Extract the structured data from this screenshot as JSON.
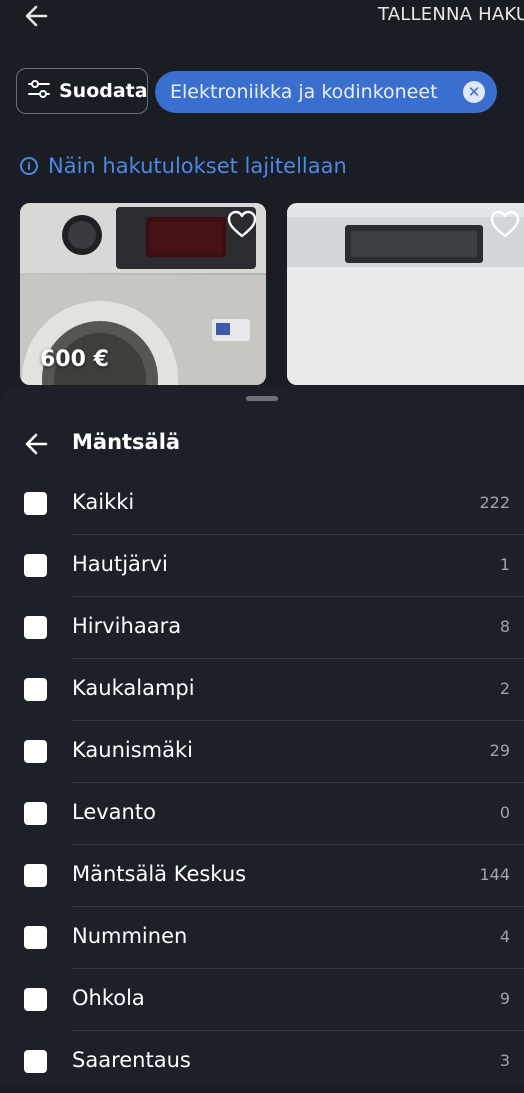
{
  "header": {
    "save_search": "TALLENNA HAKU"
  },
  "filters": {
    "filter_label": "Suodata",
    "category_chip": "Elektroniikka ja kodinkoneet",
    "chip_remove": "✕"
  },
  "info": {
    "text": "Näin hakutulokset lajitellaan",
    "icon": "i"
  },
  "listings": [
    {
      "price": "600 €"
    },
    {
      "price": ""
    }
  ],
  "sheet": {
    "title": "Mäntsälä",
    "options": [
      {
        "label": "Kaikki",
        "count": "222",
        "checked": false
      },
      {
        "label": "Hautjärvi",
        "count": "1",
        "checked": false
      },
      {
        "label": "Hirvihaara",
        "count": "8",
        "checked": false
      },
      {
        "label": "Kaukalampi",
        "count": "2",
        "checked": false
      },
      {
        "label": "Kaunismäki",
        "count": "29",
        "checked": false
      },
      {
        "label": "Levanto",
        "count": "0",
        "checked": false
      },
      {
        "label": "Mäntsälä Keskus",
        "count": "144",
        "checked": false
      },
      {
        "label": "Numminen",
        "count": "4",
        "checked": false
      },
      {
        "label": "Ohkola",
        "count": "9",
        "checked": false
      },
      {
        "label": "Saarentaus",
        "count": "3",
        "checked": false
      }
    ]
  },
  "colors": {
    "background": "#1b1d24",
    "accent": "#3a6fd0",
    "info": "#4d88e6",
    "sheet": "#1d2029"
  }
}
